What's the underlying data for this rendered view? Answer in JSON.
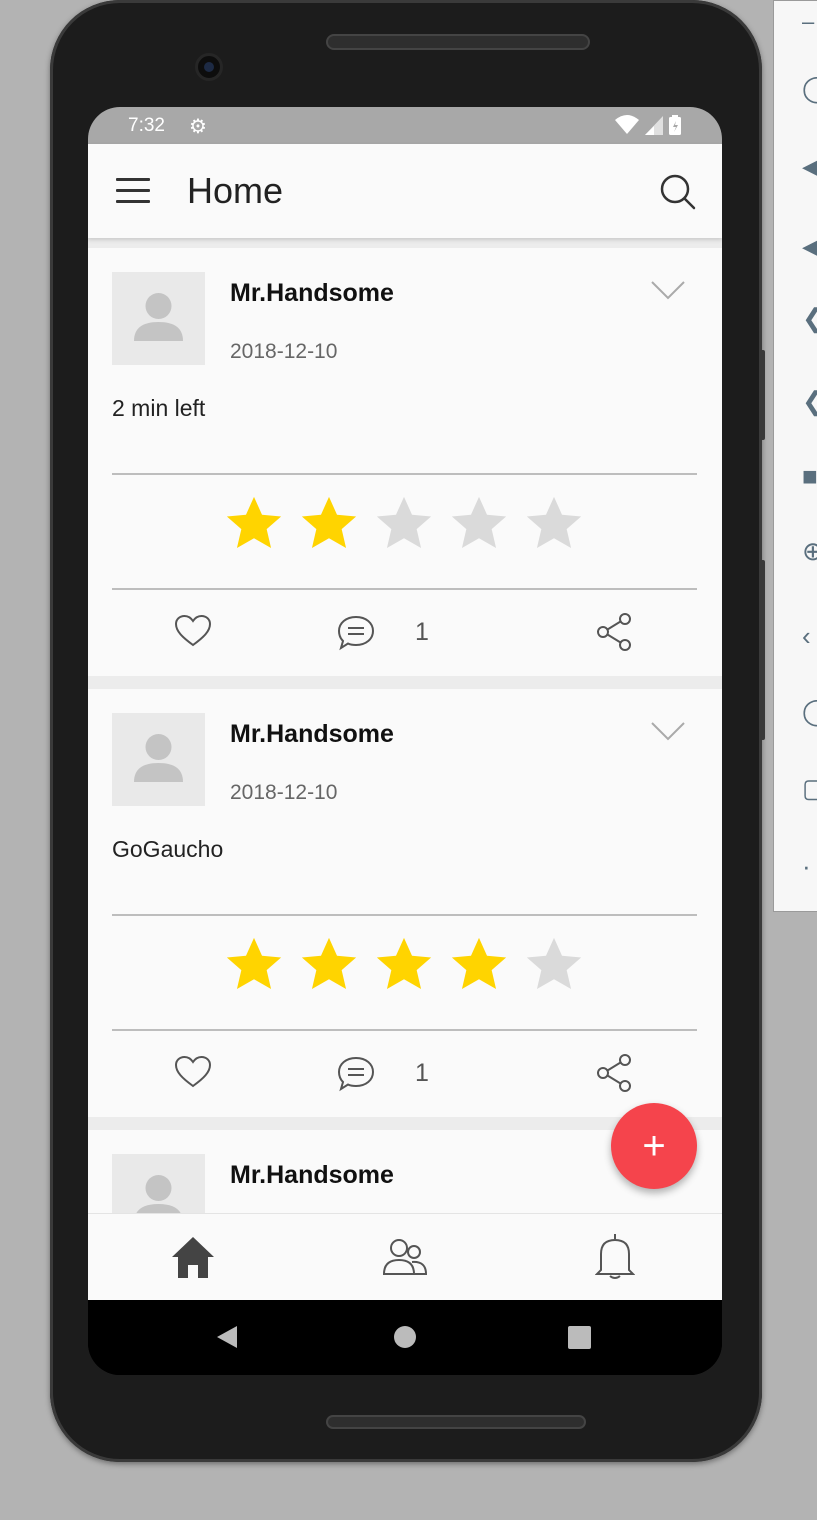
{
  "status_bar": {
    "time": "7:32",
    "settings_icon": "gear-icon",
    "wifi_icon": "wifi-icon",
    "signal_icon": "signal-icon",
    "battery_icon": "battery-icon"
  },
  "app_bar": {
    "title": "Home",
    "menu_icon": "menu-icon",
    "search_icon": "search-icon"
  },
  "posts": [
    {
      "author": "Mr.Handsome",
      "date": "2018-12-10",
      "text": "2 min left",
      "rating": 2,
      "max_rating": 5,
      "comment_count": "1"
    },
    {
      "author": "Mr.Handsome",
      "date": "2018-12-10",
      "text": "GoGaucho",
      "rating": 4,
      "max_rating": 5,
      "comment_count": "1"
    },
    {
      "author": "Mr.Handsome"
    }
  ],
  "fab": {
    "label": "+",
    "icon": "add-icon"
  },
  "bottom_nav": {
    "items": [
      {
        "icon": "home-icon",
        "active": true
      },
      {
        "icon": "people-icon",
        "active": false
      },
      {
        "icon": "bell-icon",
        "active": false
      }
    ]
  },
  "colors": {
    "star_filled": "#FFD400",
    "star_empty": "#DADADA",
    "fab": "#F5444C",
    "status_bar": "#A8A8A8",
    "background": "#B3B3B3"
  }
}
